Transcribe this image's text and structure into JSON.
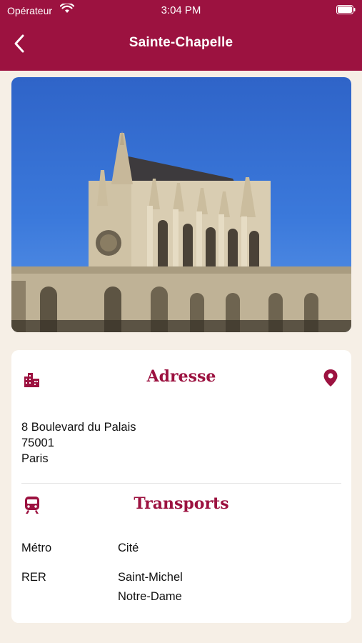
{
  "status_bar": {
    "carrier": "Opérateur",
    "time": "3:04 PM"
  },
  "nav": {
    "title": "Sainte-Chapelle"
  },
  "photo": {
    "alt": ""
  },
  "address_section": {
    "title": "Adresse",
    "lines": [
      "8 Boulevard du Palais",
      "75001",
      "Paris"
    ]
  },
  "transport_section": {
    "title": "Transports",
    "rows": [
      {
        "label": "Métro",
        "value": "Cité"
      },
      {
        "label": "RER",
        "value": "Saint-Michel\nNotre-Dame"
      }
    ]
  },
  "colors": {
    "brand": "#9c1240",
    "background": "#f6efe6",
    "card": "#ffffff"
  }
}
